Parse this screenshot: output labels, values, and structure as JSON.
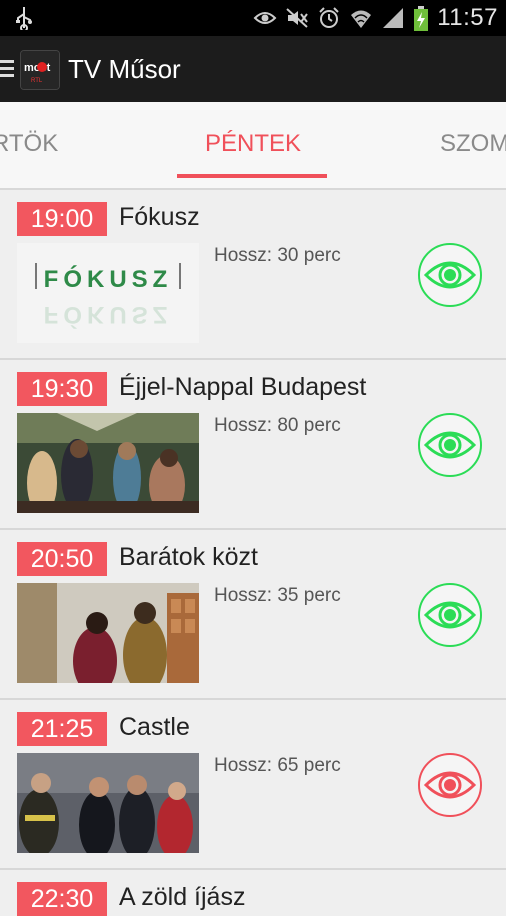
{
  "status_bar": {
    "time": "11:57",
    "icons": [
      "usb-icon",
      "eye-icon",
      "mute-icon",
      "alarm-icon",
      "wifi-icon",
      "signal-icon",
      "battery-charging-icon"
    ]
  },
  "action_bar": {
    "title": "TV Műsor",
    "app_icon_text": "most",
    "app_icon_subtext": "RTL"
  },
  "tabs": {
    "left": "RTÖK",
    "center": "PÉNTEK",
    "right": "SZOM"
  },
  "colors": {
    "accent": "#f0505a",
    "eye_green": "#2bdc56",
    "eye_red": "#f0505a"
  },
  "programs": [
    {
      "time": "19:00",
      "title": "Fókusz",
      "duration": "Hossz: 30 perc",
      "thumb_text": "FÓKUSZ",
      "eye_state": "green"
    },
    {
      "time": "19:30",
      "title": "Éjjel-Nappal Budapest",
      "duration": "Hossz: 80 perc",
      "eye_state": "green"
    },
    {
      "time": "20:50",
      "title": "Barátok közt",
      "duration": "Hossz: 35 perc",
      "eye_state": "green"
    },
    {
      "time": "21:25",
      "title": "Castle",
      "duration": "Hossz: 65 perc",
      "eye_state": "red"
    },
    {
      "time": "22:30",
      "title": "A zöld íjász"
    }
  ]
}
